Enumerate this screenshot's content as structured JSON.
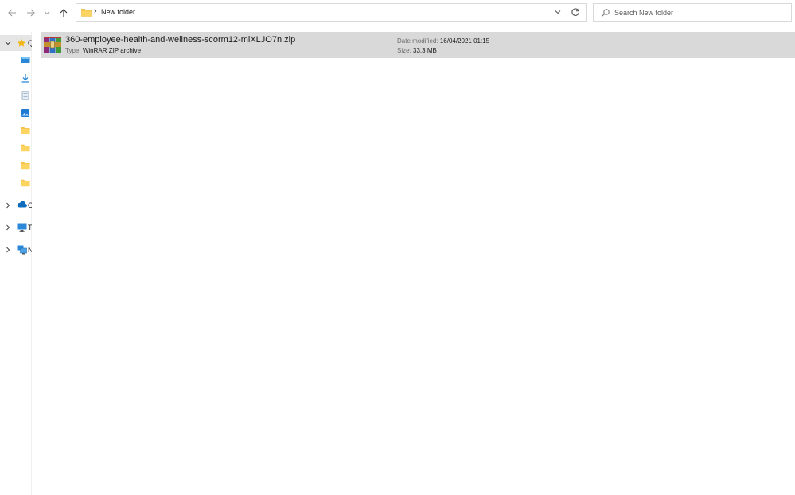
{
  "address_bar": {
    "breadcrumb": "New folder",
    "separator": "›"
  },
  "search": {
    "placeholder": "Search New folder"
  },
  "nav_pane": {
    "quick_access_label": "Q",
    "onedrive_label": "O",
    "thispc_label": "T",
    "network_label": "N",
    "quick_items": [
      {
        "icon": "desktop-icon"
      },
      {
        "icon": "downloads-icon"
      },
      {
        "icon": "documents-icon"
      },
      {
        "icon": "pictures-icon"
      },
      {
        "icon": "folder-icon"
      },
      {
        "icon": "folder-icon"
      },
      {
        "icon": "folder-icon"
      },
      {
        "icon": "folder-icon"
      }
    ]
  },
  "files": [
    {
      "name": "360-employee-health-and-wellness-scorm12-miXLJO7n.zip",
      "type_label": "Type:",
      "type": "WinRAR ZIP archive",
      "modified_label": "Date modified:",
      "modified": "16/04/2021 01:15",
      "size_label": "Size:",
      "size": "33.3 MB",
      "icon": "winrar-archive-icon"
    }
  ],
  "colors": {
    "selection": "#d9d9d9",
    "folder": "#f5c342",
    "accent": "#0f6cbd"
  }
}
